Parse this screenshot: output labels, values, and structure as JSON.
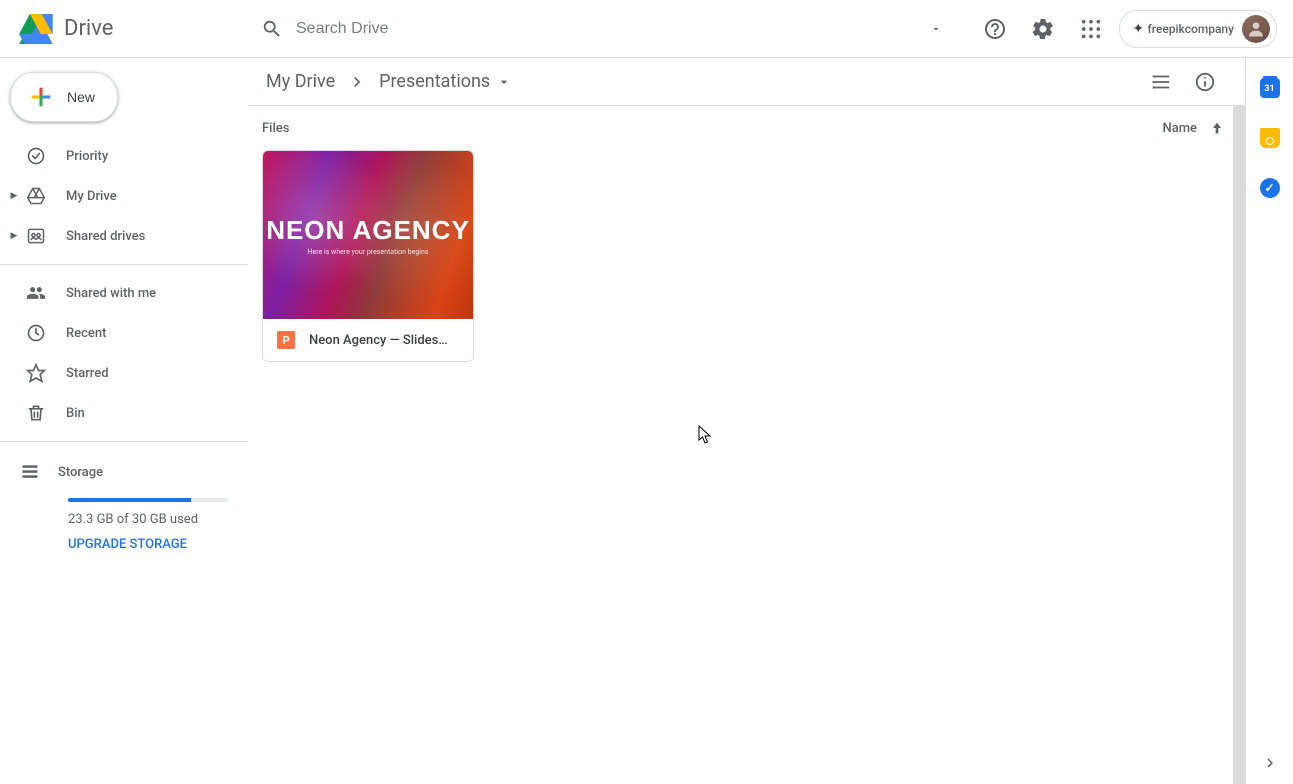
{
  "header": {
    "app_name": "Drive",
    "search_placeholder": "Search Drive",
    "company_label": "freepikcompany"
  },
  "new_button_label": "New",
  "sidebar": {
    "items": [
      {
        "label": "Priority",
        "icon": "priority"
      },
      {
        "label": "My Drive",
        "icon": "mydrive",
        "expandable": true
      },
      {
        "label": "Shared drives",
        "icon": "shared-drives",
        "expandable": true
      }
    ],
    "items2": [
      {
        "label": "Shared with me",
        "icon": "shared-with-me"
      },
      {
        "label": "Recent",
        "icon": "recent"
      },
      {
        "label": "Starred",
        "icon": "starred"
      },
      {
        "label": "Bin",
        "icon": "bin"
      }
    ],
    "storage": {
      "label": "Storage",
      "usage_text": "23.3 GB of 30 GB used",
      "upgrade_label": "UPGRADE STORAGE",
      "fill_percent": 77
    }
  },
  "breadcrumb": {
    "root": "My Drive",
    "current": "Presentations"
  },
  "section": {
    "files_label": "Files",
    "sort_column": "Name"
  },
  "files": [
    {
      "name": "Neon Agency — Slides…",
      "thumb_title": "NEON AGENCY",
      "thumb_sub": "Here is where your presentation begins",
      "type_badge": "P"
    }
  ],
  "rail": {
    "calendar_day": "31"
  }
}
